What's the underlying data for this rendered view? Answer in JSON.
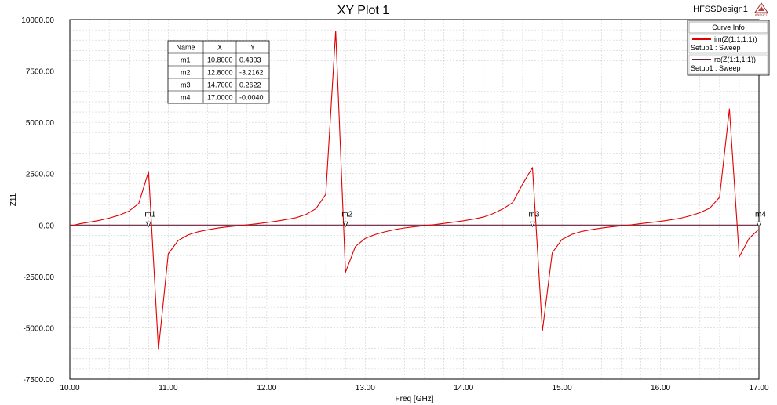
{
  "design_name": "HFSSDesign1",
  "logo_text": "ANSOFT",
  "chart_data": {
    "type": "line",
    "title": "XY Plot 1",
    "xlabel": "Freq [GHz]",
    "ylabel": "Z11",
    "xlim": [
      10.0,
      17.0
    ],
    "ylim": [
      -7500.0,
      10000.0
    ],
    "x_ticks": [
      10.0,
      11.0,
      12.0,
      13.0,
      14.0,
      15.0,
      16.0,
      17.0
    ],
    "x_tick_labels": [
      "10.00",
      "11.00",
      "12.00",
      "13.00",
      "14.00",
      "15.00",
      "16.00",
      "17.00"
    ],
    "y_ticks": [
      10000,
      7500,
      5000,
      2500,
      0,
      -2500,
      -5000,
      -7500
    ],
    "y_tick_labels": [
      "10000.00",
      "7500.00",
      "5000.00",
      "2500.00",
      "0.00",
      "-2500.00",
      "-5000.00",
      "-7500.00"
    ],
    "grid": true,
    "legend": {
      "header": "Curve Info",
      "placement": "top-right",
      "entries": [
        {
          "name": "im(Z(1:1,1:1))",
          "sub": "Setup1 : Sweep",
          "color": "#e00000"
        },
        {
          "name": "re(Z(1:1,1:1))",
          "sub": "Setup1 : Sweep",
          "color": "#6b1e3a"
        }
      ]
    },
    "series": [
      {
        "name": "im(Z(1:1,1:1))",
        "color": "#e00000",
        "x": [
          10.0,
          10.1,
          10.2,
          10.3,
          10.4,
          10.5,
          10.6,
          10.7,
          10.8,
          10.9,
          11.0,
          11.1,
          11.2,
          11.3,
          11.4,
          11.5,
          11.6,
          11.7,
          11.8,
          11.9,
          12.0,
          12.1,
          12.2,
          12.3,
          12.4,
          12.5,
          12.6,
          12.7,
          12.8,
          12.9,
          13.0,
          13.1,
          13.2,
          13.3,
          13.4,
          13.5,
          13.6,
          13.7,
          13.8,
          13.9,
          14.0,
          14.1,
          14.2,
          14.3,
          14.4,
          14.5,
          14.6,
          14.7,
          14.8,
          14.9,
          15.0,
          15.1,
          15.2,
          15.3,
          15.4,
          15.5,
          15.6,
          15.7,
          15.8,
          15.9,
          16.0,
          16.1,
          16.2,
          16.3,
          16.4,
          16.5,
          16.6,
          16.7,
          16.8,
          16.9,
          17.0
        ],
        "y": [
          -50,
          60,
          140,
          230,
          340,
          480,
          680,
          1050,
          2600,
          -6050,
          -1400,
          -750,
          -480,
          -330,
          -230,
          -150,
          -90,
          -40,
          10,
          60,
          120,
          190,
          270,
          360,
          520,
          800,
          1500,
          9450,
          -2300,
          -1050,
          -650,
          -460,
          -330,
          -220,
          -140,
          -80,
          -30,
          20,
          80,
          140,
          210,
          290,
          390,
          560,
          790,
          1100,
          2000,
          2800,
          -5150,
          -1350,
          -700,
          -450,
          -310,
          -220,
          -150,
          -90,
          -40,
          10,
          70,
          120,
          180,
          250,
          330,
          450,
          600,
          820,
          1350,
          5650,
          -1550,
          -650,
          -200
        ]
      },
      {
        "name": "re(Z(1:1,1:1))",
        "color": "#6b1e3a",
        "x": [
          10.0,
          17.0
        ],
        "y": [
          0.0,
          0.0
        ]
      }
    ],
    "markers": {
      "headers": [
        "Name",
        "X",
        "Y"
      ],
      "rows": [
        {
          "name": "m1",
          "x": 10.8,
          "y": 0.0,
          "x_text": "10.8000",
          "y_text": "0.4303"
        },
        {
          "name": "m2",
          "x": 12.8,
          "y": 0.0,
          "x_text": "12.8000",
          "y_text": "-3.2162"
        },
        {
          "name": "m3",
          "x": 14.7,
          "y": 0.0,
          "x_text": "14.7000",
          "y_text": "0.2622"
        },
        {
          "name": "m4",
          "x": 17.0,
          "y": 0.0,
          "x_text": "17.0000",
          "y_text": "-0.0040"
        }
      ]
    }
  }
}
